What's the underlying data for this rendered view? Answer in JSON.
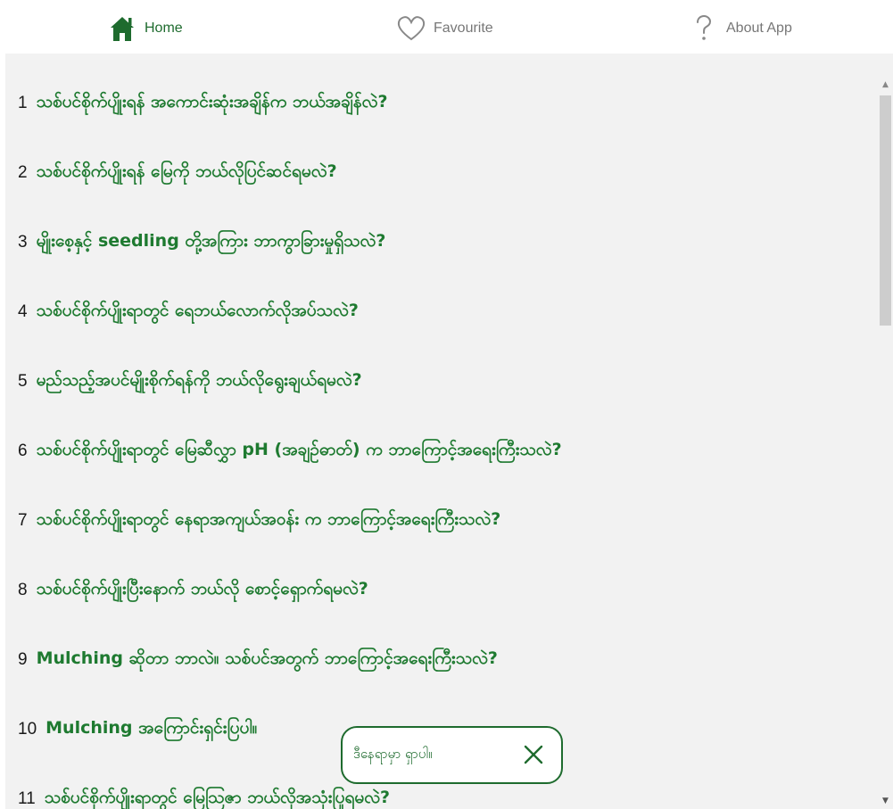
{
  "nav": {
    "items": [
      {
        "label": "Home",
        "icon": "home-icon",
        "active": true
      },
      {
        "label": "Favourite",
        "icon": "heart-icon",
        "active": false
      },
      {
        "label": "About App",
        "icon": "question-icon",
        "active": false
      }
    ]
  },
  "questions": [
    {
      "num": "1",
      "text": "သစ်ပင်စိုက်ပျိုးရန် အကောင်းဆုံးအချိန်က ဘယ်အချိန်လဲ?"
    },
    {
      "num": "2",
      "text": "သစ်ပင်စိုက်ပျိုးရန် မြေကို ဘယ်လိုပြင်ဆင်ရမလဲ?"
    },
    {
      "num": "3",
      "text": "မျိုးစေ့နှင့် seedling တို့အကြား ဘာကွာခြားမှုရှိသလဲ?"
    },
    {
      "num": "4",
      "text": "သစ်ပင်စိုက်ပျိုးရာတွင် ရေဘယ်လောက်လိုအပ်သလဲ?"
    },
    {
      "num": "5",
      "text": "မည်သည့်အပင်မျိုးစိုက်ရန်ကို ဘယ်လိုရွေးချယ်ရမလဲ?"
    },
    {
      "num": "6",
      "text": "သစ်ပင်စိုက်ပျိုးရာတွင် မြေဆီလွှာ pH (အချဉ်ဓာတ်) က ဘာကြောင့်အရေးကြီးသလဲ?"
    },
    {
      "num": "7",
      "text": "သစ်ပင်စိုက်ပျိုးရာတွင် နေရာအကျယ်အဝန်း က ဘာကြောင့်အရေးကြီးသလဲ?"
    },
    {
      "num": "8",
      "text": "သစ်ပင်စိုက်ပျိုးပြီးနောက် ဘယ်လို စောင့်ရှောက်ရမလဲ?"
    },
    {
      "num": "9",
      "text": "Mulching ဆိုတာ ဘာလဲ။ သစ်ပင်အတွက် ဘာကြောင့်အရေးကြီးသလဲ?"
    },
    {
      "num": "10",
      "text": "Mulching အကြောင်းရှင်းပြပါ။"
    },
    {
      "num": "11",
      "text": "သစ်ပင်စိုက်ပျိုးရာတွင် မြေသြဇာ ဘယ်လိုအသုံးပြုရမလဲ?"
    }
  ],
  "toast": {
    "message": "ဒီနေရာမှာ ရှာပါ။",
    "close_icon": "close-icon"
  },
  "colors": {
    "accent": "#1e7a30",
    "nav_active": "#1e6b2e",
    "nav_inactive": "#777777",
    "content_bg": "#f2f2f2"
  }
}
